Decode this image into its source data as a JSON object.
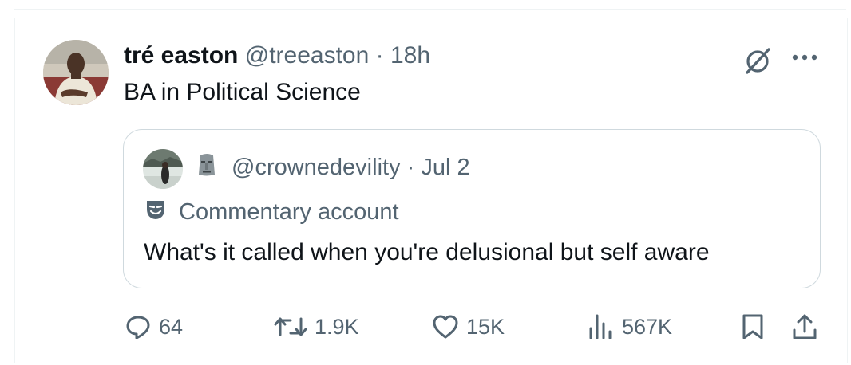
{
  "tweet": {
    "display_name": "tré easton",
    "handle": "@treeaston",
    "separator": "·",
    "time": "18h",
    "text": "BA in Political Science"
  },
  "quoted": {
    "handle": "@crownedevility",
    "separator": "·",
    "date": "Jul 2",
    "label": "Commentary account",
    "text": "What's it called when you're delusional but self aware"
  },
  "actions": {
    "replies": "64",
    "reposts": "1.9K",
    "likes": "15K",
    "views": "567K"
  },
  "icons": {
    "grok": "grok-icon",
    "more": "more-icon",
    "reply": "reply-icon",
    "repost": "repost-icon",
    "like": "heart-icon",
    "views": "views-icon",
    "bookmark": "bookmark-icon",
    "share": "share-icon",
    "label": "mask-icon"
  },
  "colors": {
    "text": "#0f1419",
    "muted": "#536471",
    "border": "#cfd9de"
  }
}
